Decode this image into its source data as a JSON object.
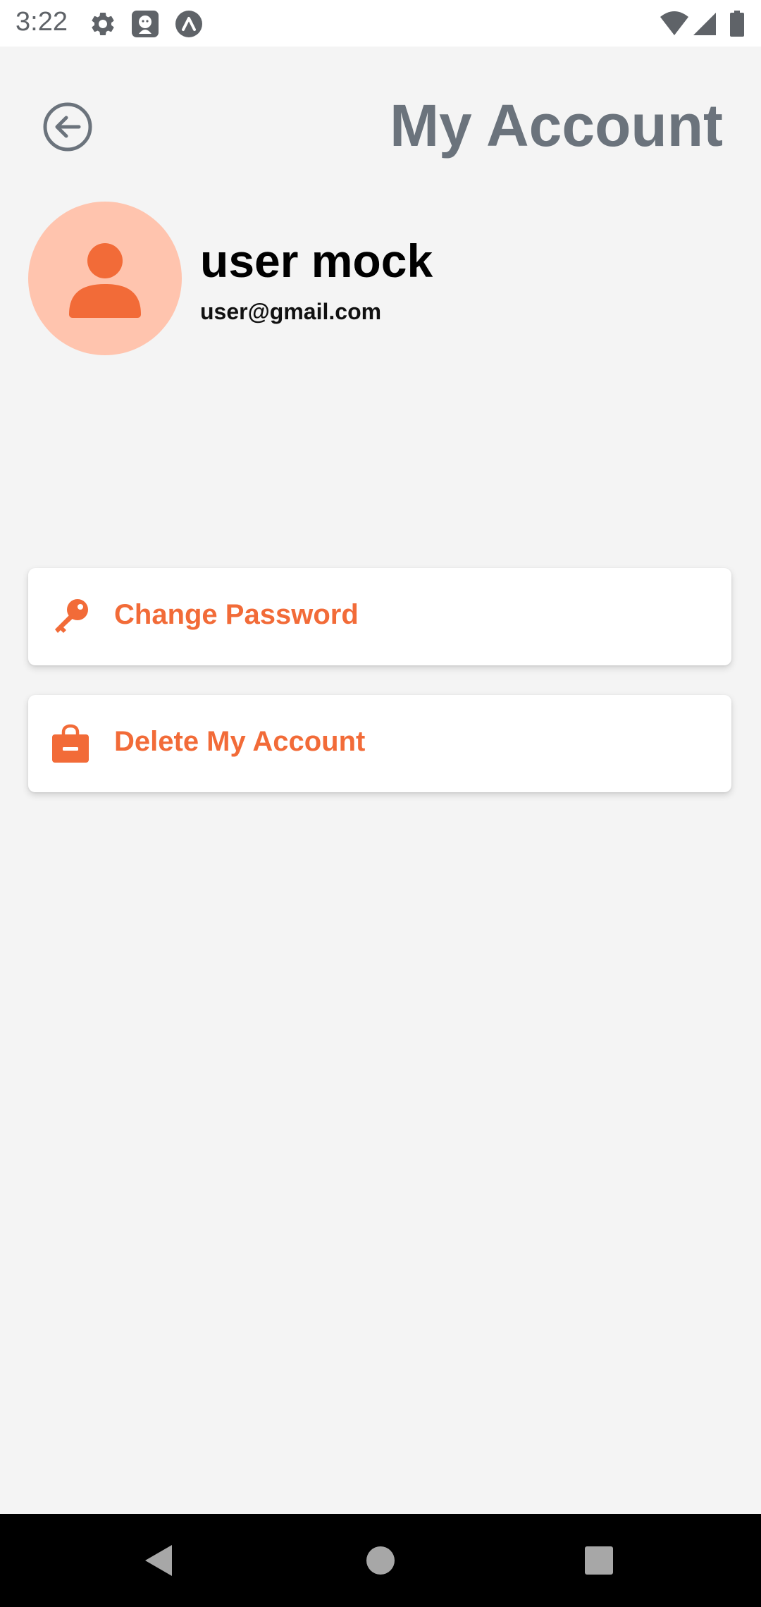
{
  "status_bar": {
    "time": "3:22",
    "left_icons": [
      "settings-icon",
      "app-notification-icon",
      "expo-icon"
    ],
    "right_icons": [
      "wifi-icon",
      "signal-icon",
      "battery-icon"
    ]
  },
  "header": {
    "title": "My Account",
    "back_icon": "back-arrow-circle-icon"
  },
  "profile": {
    "name": "user mock",
    "email": "user@gmail.com",
    "avatar_icon": "person-icon"
  },
  "actions": [
    {
      "label": "Change Password",
      "icon": "key-icon"
    },
    {
      "label": "Delete My Account",
      "icon": "bag-remove-icon"
    }
  ],
  "nav_bar": {
    "buttons": [
      "back-triangle-icon",
      "home-circle-icon",
      "recents-square-icon"
    ]
  },
  "colors": {
    "accent": "#f26b38",
    "avatar_bg": "#ffc4ae",
    "title": "#6b737c",
    "background": "#f4f4f4"
  }
}
